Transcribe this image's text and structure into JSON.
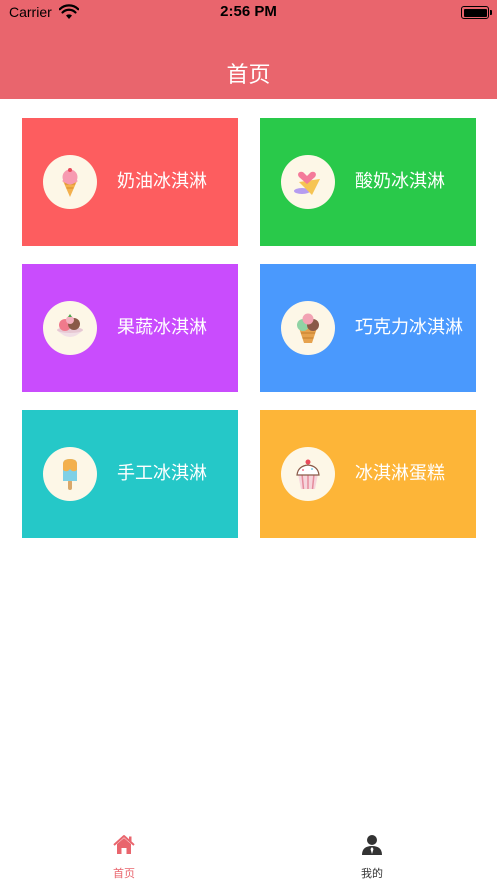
{
  "status_bar": {
    "carrier": "Carrier",
    "time": "2:56 PM"
  },
  "header": {
    "title": "首页",
    "color": "#e9656d"
  },
  "categories": [
    {
      "label": "奶油冰淇淋",
      "color": "#fd5d5f",
      "icon": "ice-cream-cone-icon"
    },
    {
      "label": "酸奶冰淇淋",
      "color": "#29c94a",
      "icon": "ice-cream-heart-icon"
    },
    {
      "label": "果蔬冰淇淋",
      "color": "#c94cfd",
      "icon": "fruit-ice-cream-bowl-icon"
    },
    {
      "label": "巧克力冰淇淋",
      "color": "#4a99fd",
      "icon": "chocolate-ice-cream-icon"
    },
    {
      "label": "手工冰淇淋",
      "color": "#25c8c8",
      "icon": "popsicle-icon"
    },
    {
      "label": "冰淇淋蛋糕",
      "color": "#fdb538",
      "icon": "ice-cream-cake-icon"
    }
  ],
  "tabbar": {
    "tabs": [
      {
        "label": "首页",
        "icon": "home-icon",
        "active": true,
        "color": "#e9656d"
      },
      {
        "label": "我的",
        "icon": "user-icon",
        "active": false,
        "color": "#333333"
      }
    ]
  }
}
